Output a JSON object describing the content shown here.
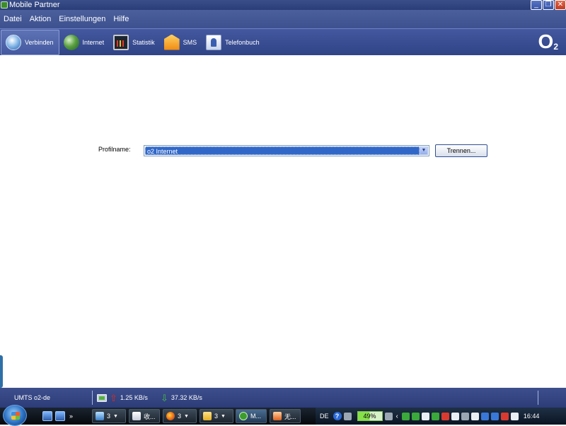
{
  "window": {
    "title": "Mobile Partner"
  },
  "menu": [
    "Datei",
    "Aktion",
    "Einstellungen",
    "Hilfe"
  ],
  "toolbar": {
    "connect": "Verbinden",
    "internet": "Internet",
    "statistics": "Statistik",
    "sms": "SMS",
    "phonebook": "Telefonbuch",
    "brand": "O",
    "brand_sub": "2"
  },
  "main": {
    "profile_label": "Profilname:",
    "profile_value": "o2 Internet",
    "disconnect_label": "Trennen..."
  },
  "status": {
    "network": "UMTS  o2-de",
    "upload_rate": "1.25 KB/s",
    "download_rate": "37.32 KB/s"
  },
  "taskbar": {
    "quick_launch_more": "»",
    "groups": [
      {
        "label": "3"
      },
      {
        "label": "收..."
      },
      {
        "label": "3"
      },
      {
        "label": "3"
      },
      {
        "label": "M..."
      },
      {
        "label": "无..."
      }
    ],
    "tray": {
      "language": "DE",
      "battery_percent": "49%",
      "battery_level": 0.49,
      "clock": "16:44"
    }
  },
  "colors": {
    "title_bar": "#2a3d78",
    "toolbar": "#3d5190",
    "selection": "#3168c8",
    "status_bar": "#2c3c78"
  }
}
